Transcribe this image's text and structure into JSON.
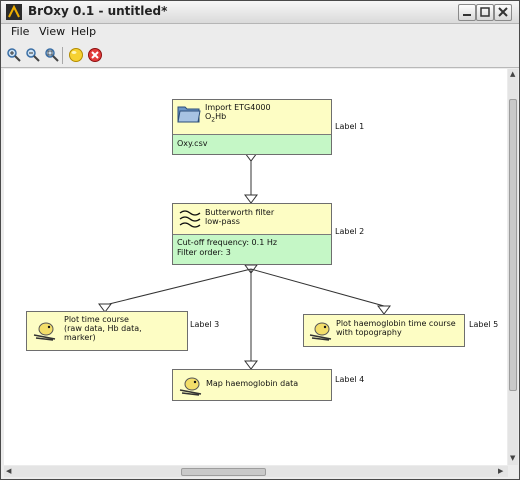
{
  "window": {
    "title": "BrOxy 0.1 - untitled*"
  },
  "menu": {
    "items": [
      "File",
      "View",
      "Help"
    ]
  },
  "toolbar": {
    "buttons": [
      "zoom-in-icon",
      "zoom-out-icon",
      "zoom-fit-icon",
      "run-icon",
      "stop-icon"
    ]
  },
  "nodes": [
    {
      "title": "Import ETG4000",
      "subtitle_main": "O",
      "subtitle_sub": "2",
      "subtitle_rest": "Hb",
      "footer": [
        "Oxy.csv"
      ],
      "label": "Label 1"
    },
    {
      "title": "Butterworth filter",
      "subtitle": "low-pass",
      "footer": [
        "Cut-off frequency: 0.1 Hz",
        "Filter order: 3"
      ],
      "label": "Label 2"
    },
    {
      "lines": [
        "Plot time course",
        "(raw data, Hb data,",
        "marker)"
      ],
      "label": "Label 3"
    },
    {
      "lines": [
        "Map haemoglobin data"
      ],
      "label": "Label 4"
    },
    {
      "lines": [
        "Plot haemoglobin time course",
        "with topography"
      ],
      "label": "Label 5"
    }
  ],
  "colors": {
    "node_header": "#fdfdc4",
    "node_footer": "#c5f7c6"
  }
}
